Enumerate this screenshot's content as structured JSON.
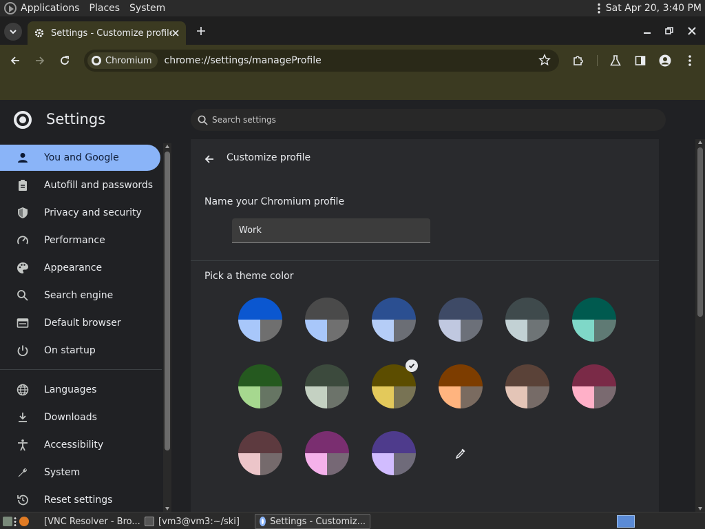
{
  "top_panel": {
    "menus": [
      "Applications",
      "Places",
      "System"
    ],
    "datetime": "Sat Apr 20,  3:40 PM"
  },
  "browser": {
    "tab_title": "Settings - Customize profile",
    "omnibox_chip": "Chromium",
    "url": "chrome://settings/manageProfile"
  },
  "settings": {
    "title": "Settings",
    "search_placeholder": "Search settings",
    "nav": [
      {
        "label": "You and Google",
        "icon": "person-icon",
        "active": true
      },
      {
        "label": "Autofill and passwords",
        "icon": "clipboard-icon"
      },
      {
        "label": "Privacy and security",
        "icon": "shield-icon"
      },
      {
        "label": "Performance",
        "icon": "speedometer-icon"
      },
      {
        "label": "Appearance",
        "icon": "palette-icon"
      },
      {
        "label": "Search engine",
        "icon": "search-icon"
      },
      {
        "label": "Default browser",
        "icon": "browser-window-icon"
      },
      {
        "label": "On startup",
        "icon": "power-icon"
      },
      {
        "label": "Languages",
        "icon": "globe-icon"
      },
      {
        "label": "Downloads",
        "icon": "download-icon"
      },
      {
        "label": "Accessibility",
        "icon": "accessibility-icon"
      },
      {
        "label": "System",
        "icon": "wrench-icon"
      },
      {
        "label": "Reset settings",
        "icon": "reset-icon"
      }
    ]
  },
  "customize_profile": {
    "title": "Customize profile",
    "name_label": "Name your Chromium profile",
    "name_value": "Work",
    "theme_label": "Pick a theme color",
    "selected_index": 8,
    "themes": [
      {
        "top": "#0b57d0",
        "left": "#a8c7fa",
        "right": "#6f6f6f"
      },
      {
        "top": "#4a4a4a",
        "left": "#a8c7fa",
        "right": "#707070"
      },
      {
        "top": "#2b4f91",
        "left": "#b5cdf7",
        "right": "#6b6e75"
      },
      {
        "top": "#3e4a66",
        "left": "#c0c8e0",
        "right": "#6c7079"
      },
      {
        "top": "#3f4a4c",
        "left": "#c2d1d4",
        "right": "#6e7476"
      },
      {
        "top": "#005a4f",
        "left": "#7fd8c8",
        "right": "#5f7a74"
      },
      {
        "top": "#25591f",
        "left": "#a6d88f",
        "right": "#667563"
      },
      {
        "top": "#3c4a3d",
        "left": "#c4d1c2",
        "right": "#6c736a"
      },
      {
        "top": "#5c4d00",
        "left": "#e3c95b",
        "right": "#787354"
      },
      {
        "top": "#7d3d00",
        "left": "#ffb47f",
        "right": "#7a6b60"
      },
      {
        "top": "#5a4238",
        "left": "#e4c5b7",
        "right": "#766b67"
      },
      {
        "top": "#7a2a47",
        "left": "#ffb0c8",
        "right": "#7a6a70"
      },
      {
        "top": "#5d3a3f",
        "left": "#ecc5c9",
        "right": "#756a6c"
      },
      {
        "top": "#7a2e70",
        "left": "#f5b1eb",
        "right": "#766875"
      },
      {
        "top": "#4e3b8c",
        "left": "#d1bcff",
        "right": "#6f6b7a"
      }
    ]
  },
  "taskbar": {
    "tasks": [
      "[VNC Resolver - Bro...",
      "[vm3@vm3:~/ski]",
      "Settings - Customiz..."
    ]
  },
  "colors": {
    "toolbar": "#3b3a21",
    "active_nav": "#8ab4f8",
    "page_bg": "#202124",
    "card_bg": "#292a2d"
  }
}
